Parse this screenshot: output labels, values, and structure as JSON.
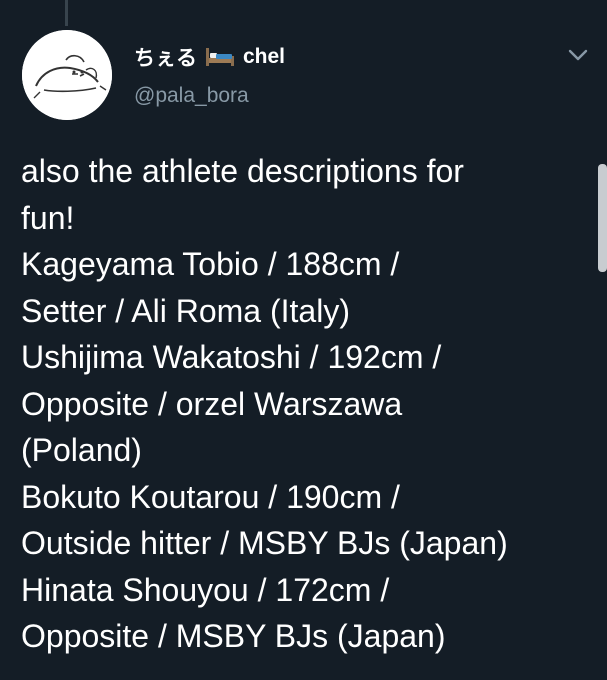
{
  "tweet": {
    "display_name": "ちぇる",
    "display_name_suffix": "chel",
    "name_emoji_icon": "bed-icon",
    "handle": "@pala_bora",
    "menu_icon": "chevron-down-icon",
    "text": "also the athlete descriptions for\nfun!\nKageyama Tobio / 188cm /\nSetter / Ali Roma (Italy)\nUshijima Wakatoshi / 192cm /\nOpposite / orzel Warszawa\n(Poland)\nBokuto Koutarou / 190cm /\nOutside hitter / MSBY BJs (Japan)\nHinata Shouyou / 172cm /\nOpposite / MSBY BJs (Japan)"
  },
  "colors": {
    "background": "#141d26",
    "text_primary": "#ffffff",
    "text_secondary": "#8899a6",
    "thread_line": "#38444d"
  }
}
